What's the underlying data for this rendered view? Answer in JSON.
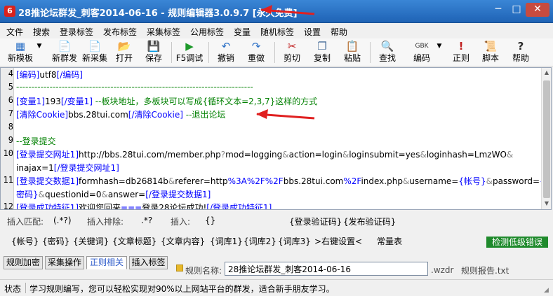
{
  "window": {
    "title": "28推论坛群发_刺客2014-06-16 - 规则编辑器3.0.9.7 [永久免费]",
    "app_icon": "6",
    "buttons": [
      "─",
      "□",
      "✕"
    ]
  },
  "menu": [
    "文件",
    "搜索",
    "登录标签",
    "发布标签",
    "采集标签",
    "公用标签",
    "变量",
    "随机标签",
    "设置",
    "帮助"
  ],
  "toolbar": [
    {
      "label": "新模板",
      "icon": "new-template-icon",
      "glyph": "▦"
    },
    {
      "label": "新群发",
      "icon": "new-post-icon",
      "glyph": "📄"
    },
    {
      "label": "新采集",
      "icon": "new-collect-icon",
      "glyph": "📄"
    },
    {
      "label": "打开",
      "icon": "open-folder-icon",
      "glyph": "📂"
    },
    {
      "label": "保存",
      "icon": "save-icon",
      "glyph": "💾"
    },
    {
      "label": "F5调试",
      "icon": "play-icon",
      "glyph": "▶"
    },
    {
      "label": "撤销",
      "icon": "undo-icon",
      "glyph": "↶"
    },
    {
      "label": "重做",
      "icon": "redo-icon",
      "glyph": "↷"
    },
    {
      "label": "剪切",
      "icon": "cut-icon",
      "glyph": "✂"
    },
    {
      "label": "复制",
      "icon": "copy-icon",
      "glyph": "❐"
    },
    {
      "label": "粘贴",
      "icon": "paste-icon",
      "glyph": "📋"
    },
    {
      "label": "查找",
      "icon": "find-icon",
      "glyph": "🔍"
    },
    {
      "label": "编码",
      "icon": "encoding-icon",
      "glyph": "GBK"
    },
    {
      "label": "正则",
      "icon": "regex-icon",
      "glyph": "!"
    },
    {
      "label": "脚本",
      "icon": "script-icon",
      "glyph": "📜"
    },
    {
      "label": "帮助",
      "icon": "help-icon",
      "glyph": "?"
    }
  ],
  "editor": {
    "lines": [
      {
        "n": "4",
        "t": "[编码]utf8[/编码]"
      },
      {
        "n": "5",
        "t": "------------------------------------------------------------------------------"
      },
      {
        "n": "6",
        "t": "[变量1]193[/变量1] --板块地址，多板块可以写成{循环文本=2,3,7}这样的方式"
      },
      {
        "n": "7",
        "t": "[清除Cookie]bbs.28tui.com[/清除Cookie] --退出论坛"
      },
      {
        "n": "8",
        "t": ""
      },
      {
        "n": "9",
        "t": "--登录提交"
      },
      {
        "n": "10",
        "t": "[登录提交网址1]http://bbs.28tui.com/member.php?mod=logging&action=login&loginsubmit=yes&loginhash=LmzWO&"
      },
      {
        "n": "",
        "t": "inajax=1[/登录提交网址1]"
      },
      {
        "n": "11",
        "t": "[登录提交数据1]formhash=db26814b&referer=http%3A%2F%2Fbbs.28tui.com%2Findex.php&username={帐号}&password={"
      },
      {
        "n": "",
        "t": "密码}&questionid=0&answer=[/登录提交数据1]"
      },
      {
        "n": "12",
        "t": "[登录成功特征1]欢迎您回来===登录28论坛成功![/登录成功特征1]"
      }
    ]
  },
  "hints": {
    "insert_match": "插入匹配:",
    "insert_match_val": "(.*?)",
    "insert_exclude": "插入排除:",
    "insert_exclude_val": ".*?",
    "insert": "插入:",
    "insert_val": "{}",
    "captcha_login": "{登录验证码}",
    "captcha_post": "{发布验证码}"
  },
  "variables": [
    "{帐号}",
    "{密码}",
    "{关键词}",
    "{文章标题}",
    "{文章内容}",
    "{词库1}",
    "{词库2}",
    "{词库3}",
    ">右键设置<",
    "常量表"
  ],
  "check_button": "检测低级错误",
  "tabs": [
    "规则加密",
    "采集操作",
    "正则相关",
    "插入标签"
  ],
  "active_tab": 2,
  "rule_name_label": "规则名称:",
  "rule_name_value": "28推论坛群发_刺客2014-06-16",
  "rule_ext": ".wzdr",
  "rule_report": "规则报告.txt",
  "status": {
    "label": "状态",
    "message": "学习规则编写，您可以轻松实现对90%以上网站平台的群发，适合新手朋友学习。"
  },
  "colors": {
    "title_bg": "#2a6fc6",
    "tag_blue": "#0000ff",
    "comment_green": "#008000",
    "check_button_bg": "#1f8a2c",
    "arrow_red": "#e02020"
  }
}
